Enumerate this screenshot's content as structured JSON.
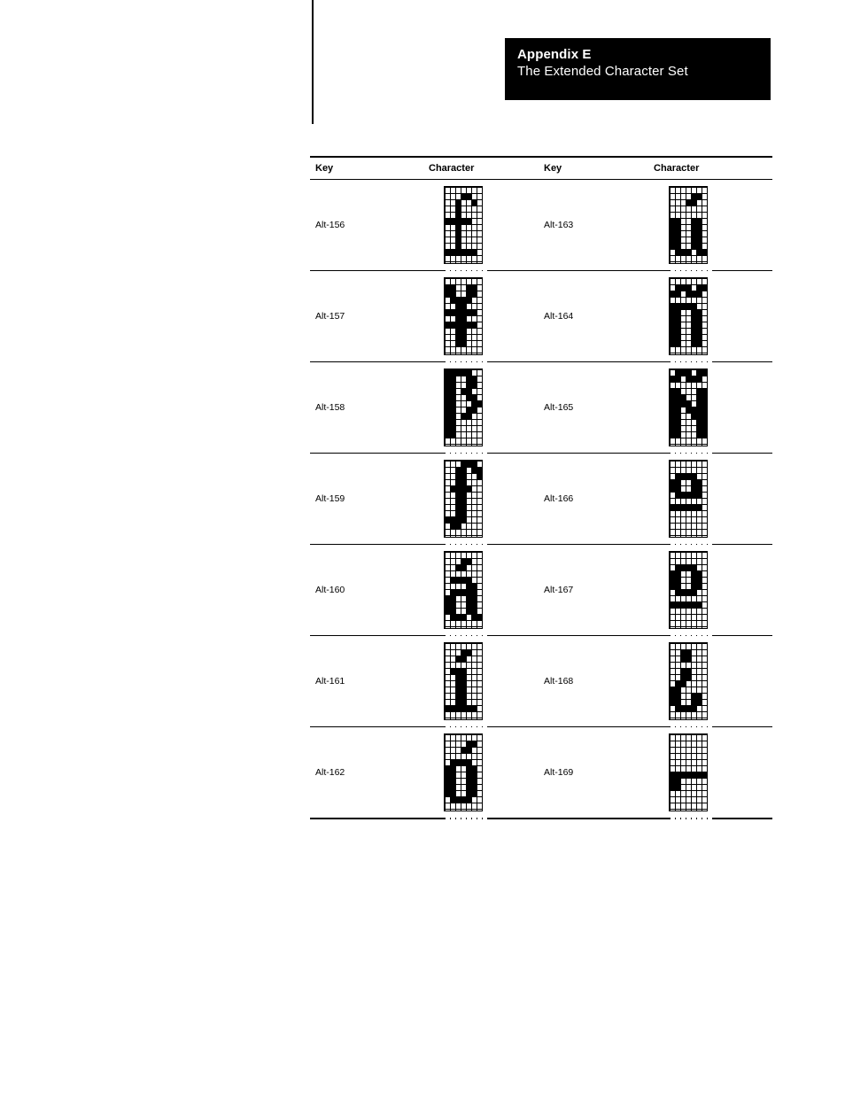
{
  "header": {
    "appendix_label": "Appendix E",
    "subtitle": "The Extended Character Set"
  },
  "table": {
    "columns": [
      "Key",
      "Character",
      "Key",
      "Character"
    ],
    "rows": [
      {
        "left_key": "Alt-156",
        "left_char_name": "pound-sterling-sign",
        "left_char": "£",
        "left_bitmap": "00000000,00011000,00100100,00100000,00100000,11111000,00100000,00100000,00100000,00100000,11111100,00000000,00000000,00000000",
        "right_key": "Alt-163",
        "right_char_name": "u-acute",
        "right_char": "ú",
        "right_bitmap": "00000000,00001100,00011000,00000000,00000000,11001100,11001100,11001100,11001100,11001100,01110110,00000000,00000000,00000000"
      },
      {
        "left_key": "Alt-157",
        "left_char_name": "yen-sign",
        "left_char": "¥",
        "left_bitmap": "00000000,11001100,11001100,01111000,00110000,11111100,00110000,11111100,00110000,00110000,00110000,00000000,00000000,00000000",
        "right_key": "Alt-164",
        "right_char_name": "n-tilde",
        "right_char": "ñ",
        "right_bitmap": "00000000,01110110,11011100,00000000,11111000,11001100,11001100,11001100,11001100,11001100,11001100,00000000,00000000,00000000"
      },
      {
        "left_key": "Alt-158",
        "left_char_name": "peseta-sign",
        "left_char": "₧",
        "left_bitmap": "11111000,11001100,11001100,11011000,11001100,11000110,11001100,11011000,11000000,11000000,11000000,00000000,00000000,00000000",
        "right_key": "Alt-165",
        "right_char_name": "capital-n-tilde",
        "right_char": "Ñ",
        "right_bitmap": "01110110,11011100,00000000,11000110,11100110,11110110,11011110,11001110,11000110,11000110,11000110,00000000,00000000,00000000"
      },
      {
        "left_key": "Alt-159",
        "left_char_name": "florin-sign",
        "left_char": "ƒ",
        "left_bitmap": "00011100,00110110,00110010,00110000,01111000,00110000,00110000,00110000,00110000,11110000,01100000,00000000,00000000,00000000",
        "right_key": "Alt-166",
        "right_char_name": "feminine-ordinal-indicator",
        "right_char": "ª",
        "right_bitmap": "00000000,00000000,01111000,11001100,11001100,01111100,00000000,11111100,00000000,00000000,00000000,00000000,00000000,00000000"
      },
      {
        "left_key": "Alt-160",
        "left_char_name": "a-acute",
        "left_char": "á",
        "left_bitmap": "00000000,00011000,00110000,00000000,01111000,00001100,01111100,11001100,11001100,11001100,01110110,00000000,00000000,00000000",
        "right_key": "Alt-167",
        "right_char_name": "masculine-ordinal-indicator",
        "right_char": "º",
        "right_bitmap": "00000000,00000000,01111000,11001100,11001100,11001100,01111000,00000000,11111100,00000000,00000000,00000000,00000000,00000000"
      },
      {
        "left_key": "Alt-161",
        "left_char_name": "i-acute",
        "left_char": "í",
        "left_bitmap": "00000000,00011000,00110000,00000000,01110000,00110000,00110000,00110000,00110000,00110000,11111100,00000000,00000000,00000000",
        "right_key": "Alt-168",
        "right_char_name": "inverted-question-mark",
        "right_char": "¿",
        "right_bitmap": "00000000,00110000,00110000,00000000,00110000,00110000,01100000,11000000,11001100,11001100,01111000,00000000,00000000,00000000"
      },
      {
        "left_key": "Alt-162",
        "left_char_name": "o-acute",
        "left_char": "ó",
        "left_bitmap": "00000000,00001100,00011000,00000000,01111000,11001100,11001100,11001100,11001100,11001100,01111000,00000000,00000000,00000000",
        "right_key": "Alt-169",
        "right_char_name": "reversed-not-sign",
        "right_char": "⌐",
        "right_bitmap": "00000000,00000000,00000000,00000000,00000000,00000000,11111110,11000000,11000000,00000000,00000000,00000000,00000000,00000000"
      }
    ]
  }
}
